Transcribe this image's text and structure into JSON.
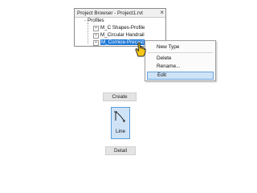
{
  "project_browser": {
    "title": "Project Browser - Project1.rvt",
    "close_glyph": "×",
    "tree": {
      "root_label": "Profiles",
      "items": [
        {
          "label": "M_C Shapes-Profile",
          "expand_glyph": "+"
        },
        {
          "label": "M_Circular Handrail",
          "expand_glyph": "+"
        },
        {
          "label": "M_Cornice-Precast",
          "expand_glyph": "+",
          "selected": true
        }
      ]
    }
  },
  "context_menu": {
    "items": [
      {
        "label": "New Type"
      },
      {
        "label": "Delete"
      },
      {
        "label": "Rename..."
      },
      {
        "label": "Edit",
        "highlighted": true
      }
    ]
  },
  "ribbon": {
    "create_label": "Create",
    "line_button_label": "Line",
    "detail_label": "Detail"
  },
  "colors": {
    "selection": "#1e78d7",
    "highlight": "#cfe3f7",
    "cursor_fill": "#f5c518"
  },
  "icons": {
    "cursor": "hand-pointer-icon",
    "line_tool": "line-draw-icon"
  }
}
